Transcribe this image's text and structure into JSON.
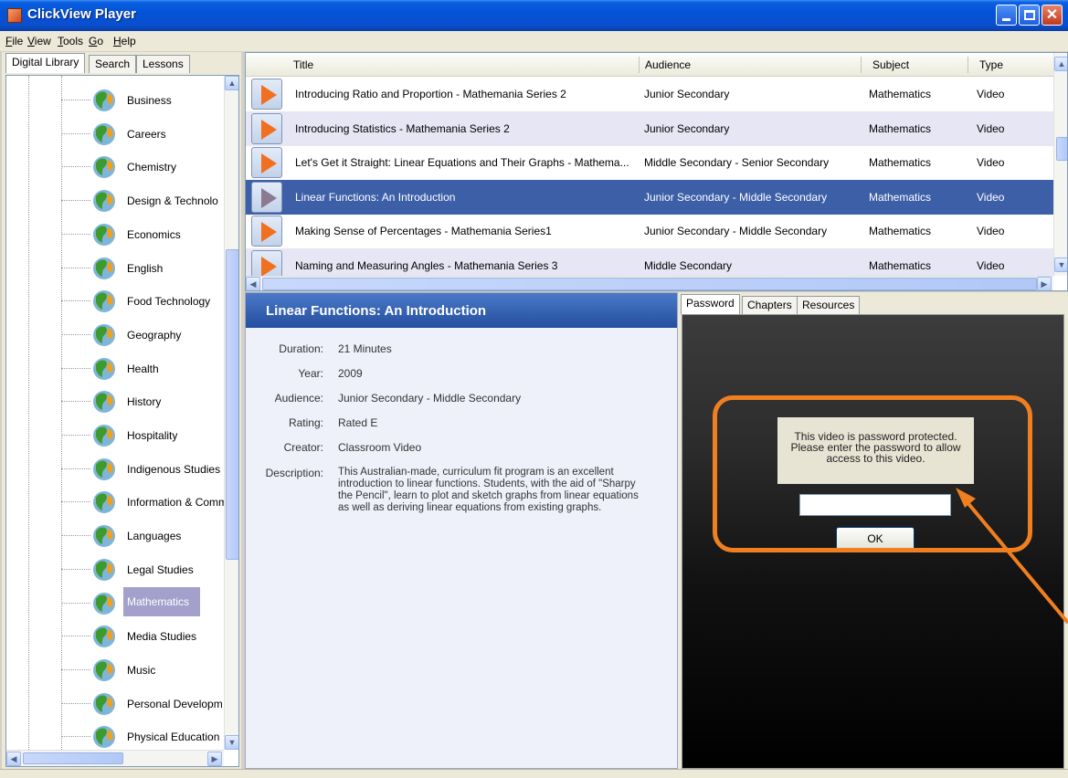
{
  "window": {
    "title": "ClickView Player"
  },
  "menu": [
    "File",
    "View",
    "Tools",
    "Go",
    "Help"
  ],
  "left_tabs": [
    "Digital Library",
    "Search",
    "Lessons"
  ],
  "subjects": [
    "Business",
    "Careers",
    "Chemistry",
    "Design & Technolo",
    "Economics",
    "English",
    "Food Technology",
    "Geography",
    "Health",
    "History",
    "Hospitality",
    "Indigenous Studies",
    "Information & Comm",
    "Languages",
    "Legal Studies",
    "Mathematics",
    "Media Studies",
    "Music",
    "Personal Developm",
    "Physical Education"
  ],
  "selected_subject": "Mathematics",
  "grid": {
    "columns": [
      "Title",
      "Audience",
      "Subject",
      "Type"
    ],
    "rows": [
      {
        "title": "Introducing Ratio and Proportion - Mathemania Series 2",
        "audience": "Junior Secondary",
        "subject": "Mathematics",
        "type": "Video"
      },
      {
        "title": "Introducing Statistics - Mathemania Series 2",
        "audience": "Junior Secondary",
        "subject": "Mathematics",
        "type": "Video"
      },
      {
        "title": "Let's Get it Straight: Linear Equations and Their Graphs - Mathema...",
        "audience": "Middle Secondary - Senior Secondary",
        "subject": "Mathematics",
        "type": "Video"
      },
      {
        "title": "Linear Functions: An Introduction",
        "audience": "Junior Secondary - Middle Secondary",
        "subject": "Mathematics",
        "type": "Video"
      },
      {
        "title": "Making Sense of Percentages - Mathemania Series1",
        "audience": "Junior Secondary - Middle Secondary",
        "subject": "Mathematics",
        "type": "Video"
      },
      {
        "title": "Naming and Measuring Angles - Mathemania Series 3",
        "audience": "Middle Secondary",
        "subject": "Mathematics",
        "type": "Video"
      }
    ]
  },
  "details": {
    "title": "Linear Functions: An Introduction",
    "labels": {
      "duration": "Duration:",
      "year": "Year:",
      "audience": "Audience:",
      "rating": "Rating:",
      "creator": "Creator:",
      "description": "Description:"
    },
    "duration": "21 Minutes",
    "year": "2009",
    "audience": "Junior Secondary - Middle Secondary",
    "rating": "Rated E",
    "creator": "Classroom Video",
    "description": "This Australian-made, curriculum fit program is an excellent introduction to linear functions. Students, with the aid of \"Sharpy the Pencil\", learn to plot and sketch graphs from linear equations as well as deriving linear equations from existing graphs."
  },
  "right_tabs": [
    "Password",
    "Chapters",
    "Resources"
  ],
  "password": {
    "message": "This video is password protected. Please enter the password to allow access to this video.",
    "input_value": "",
    "ok_label": "OK"
  },
  "colors": {
    "highlight": "#f07f1f",
    "selection": "#3d5fa8"
  }
}
